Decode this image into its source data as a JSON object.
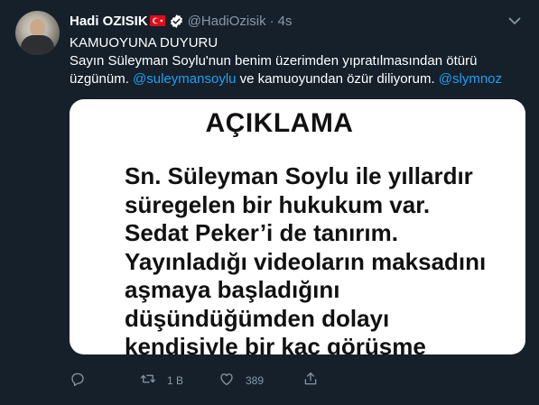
{
  "tweet": {
    "author_name": "Hadi OZISIK",
    "handle": "@HadiOzisik",
    "separator": "·",
    "time": "4s",
    "text_lines": [
      [
        {
          "t": "KAMUOYUNA DUYURU",
          "m": false
        }
      ],
      [
        {
          "t": "Sayın Süleyman Soylu'nun benim üzerimden yıpratılmasından ötürü",
          "m": false
        }
      ],
      [
        {
          "t": "üzgünüm. ",
          "m": false
        },
        {
          "t": "@suleymansoylu",
          "m": true
        },
        {
          "t": " ve kamuoyundan özür diliyorum. ",
          "m": false
        },
        {
          "t": "@slymnoz",
          "m": true
        }
      ]
    ],
    "media": {
      "title": "AÇIKLAMA",
      "lines": [
        "Sn. Süleyman Soylu ile yıllardır",
        "süregelen bir hukukum var.",
        "Sedat Peker’i de tanırım.",
        "Yayınladığı videoların maksadını",
        "aşmaya başladığını",
        "düşündüğümden dolayı",
        "kendisiyle bir kaç görüşme"
      ]
    },
    "actions": {
      "reply_count": "",
      "retweet_count": "1 B",
      "like_count": "389"
    }
  },
  "icons": {
    "verified": "verified-badge-icon",
    "flag": "turkey-flag-icon",
    "caret": "chevron-down-icon",
    "reply": "reply-icon",
    "retweet": "retweet-icon",
    "like": "heart-icon",
    "share": "share-icon"
  },
  "colors": {
    "background": "#15202b",
    "text": "#ffffff",
    "secondary": "#8899a6",
    "link": "#1da1f2",
    "flag": "#e30a17"
  }
}
